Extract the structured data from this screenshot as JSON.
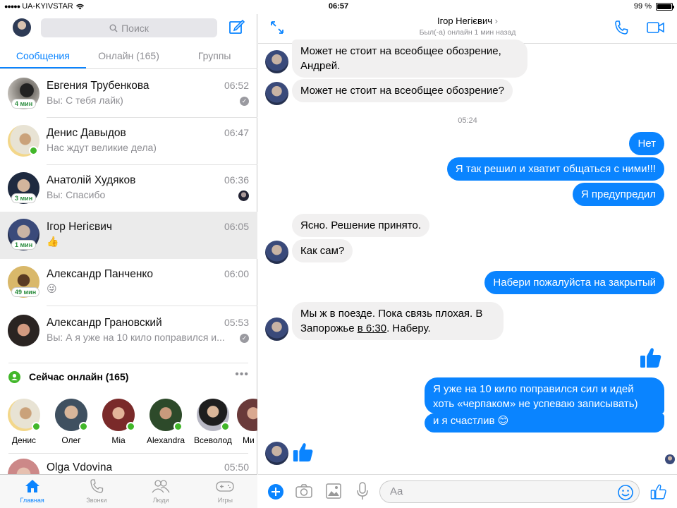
{
  "status_bar": {
    "carrier": "UA-KYIVSTAR",
    "time": "06:57",
    "battery": "99 %",
    "battery_level": 0.99
  },
  "sidebar": {
    "search_placeholder": "Поиск",
    "tabs": [
      {
        "label": "Сообщения",
        "active": true
      },
      {
        "label": "Онлайн (165)",
        "active": false
      },
      {
        "label": "Группы",
        "active": false
      }
    ],
    "conversations": [
      {
        "name": "Евгения Трубенкова",
        "time": "06:52",
        "preview": "Вы: С тебя лайк)",
        "badge": "4 мин",
        "avatar_color": "#6d6a66"
      },
      {
        "name": "Денис Давыдов",
        "time": "06:47",
        "preview": "Нас ждут великие дела)",
        "badge": "",
        "avatar_color": "#c9b58a"
      },
      {
        "name": "Анатолій Худяков",
        "time": "06:36",
        "preview": "Вы: Спасибо",
        "badge": "3 мин",
        "avatar_color": "#2f3a52"
      },
      {
        "name": "Ігор Негієвич",
        "time": "06:05",
        "preview": "👍",
        "badge": "1 мин",
        "avatar_color": "#3a4a7a"
      },
      {
        "name": "Александр Панченко",
        "time": "06:00",
        "preview": "😜",
        "badge": "49 мин",
        "avatar_color": "#b89a5e"
      },
      {
        "name": "Александр Грановский",
        "time": "05:53",
        "preview": "Вы: А я уже на 10 кило поправился и...",
        "badge": "",
        "avatar_color": "#6b4a3a"
      }
    ],
    "online_section": {
      "title": "Сейчас онлайн (165)",
      "people": [
        {
          "name": "Денис",
          "color": "#c9b58a"
        },
        {
          "name": "Олег",
          "color": "#445566"
        },
        {
          "name": "Mia",
          "color": "#9b3a3a"
        },
        {
          "name": "Alexandra",
          "color": "#2d4a2a"
        },
        {
          "name": "Всеволод",
          "color": "#444"
        },
        {
          "name": "Ми",
          "color": "#7a5a5a"
        }
      ]
    },
    "last_conversation": {
      "name": "Olga Vdovina",
      "time": "05:50"
    },
    "tab_bar": [
      {
        "label": "Главная",
        "icon": "home-icon",
        "active": true
      },
      {
        "label": "Звонки",
        "icon": "phone-icon",
        "active": false
      },
      {
        "label": "Люди",
        "icon": "people-icon",
        "active": false
      },
      {
        "label": "Игры",
        "icon": "gamepad-icon",
        "active": false
      }
    ]
  },
  "chat": {
    "contact_name": "Ігор Негієвич",
    "contact_status": "Был(-а) онлайн 1 мин назад",
    "messages": {
      "m1": "Может не стоит на всеобщее обозрение, Андрей.",
      "m2": "Может не стоит на всеобщее обозрение?",
      "timestamp": "05:24",
      "m3": "Нет",
      "m4": "Я так решил и хватит общаться с ними!!!",
      "m5": "Я предупредил",
      "m6": "Ясно. Решение принято.",
      "m7": "Как сам?",
      "m8": "Набери пожалуйста на закрытый",
      "m9_a": "Мы ж в поезде. Пока связь плохая. В Запорожье ",
      "m9_link": "в 6:30",
      "m9_b": ". Наберу.",
      "m10": "Я уже на 10 кило поправился сил и идей хоть «черпаком» не успеваю записывать)",
      "m10_b": "и я счастлив 😊"
    },
    "input_placeholder": "Aa"
  },
  "colors": {
    "accent": "#0a84ff",
    "online": "#42b72a"
  }
}
